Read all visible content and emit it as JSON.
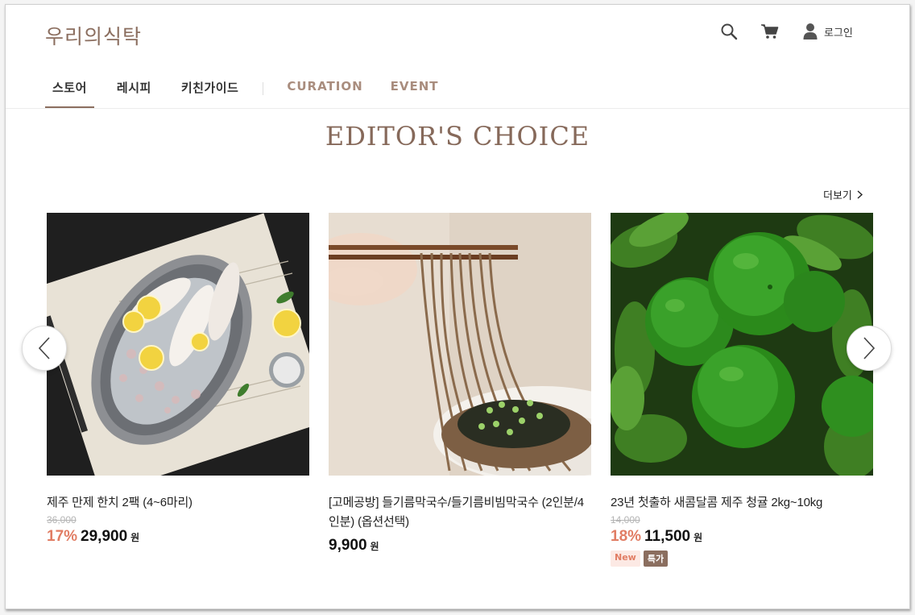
{
  "header": {
    "logo": "우리의식탁",
    "login_label": "로그인",
    "icons": [
      "search-icon",
      "cart-icon",
      "user-icon"
    ]
  },
  "nav": {
    "items": [
      {
        "label": "스토어",
        "active": true
      },
      {
        "label": "레시피"
      },
      {
        "label": "키친가이드"
      },
      {
        "label": "CURATION"
      },
      {
        "label": "EVENT"
      }
    ]
  },
  "section": {
    "title": "EDITOR'S CHOICE",
    "more_label": "더보기"
  },
  "products": [
    {
      "name": "제주 만제 한치 2팩 (4~6마리)",
      "original_price": "36,000",
      "discount": "17%",
      "price": "29,900",
      "unit": "원"
    },
    {
      "name": "[고메공방] 들기름막국수/들기름비빔막국수 (2인분/4인분) (옵션선택)",
      "price": "9,900",
      "unit": "원"
    },
    {
      "name": "23년 첫출하 새콤달콤 제주 청귤 2kg~10kg",
      "original_price": "14,000",
      "discount": "18%",
      "price": "11,500",
      "unit": "원",
      "badges": [
        "New",
        "특가"
      ]
    }
  ],
  "colors": {
    "brand": "#8b6e5f",
    "accent": "#a98d7e",
    "discount": "#e17d64"
  }
}
